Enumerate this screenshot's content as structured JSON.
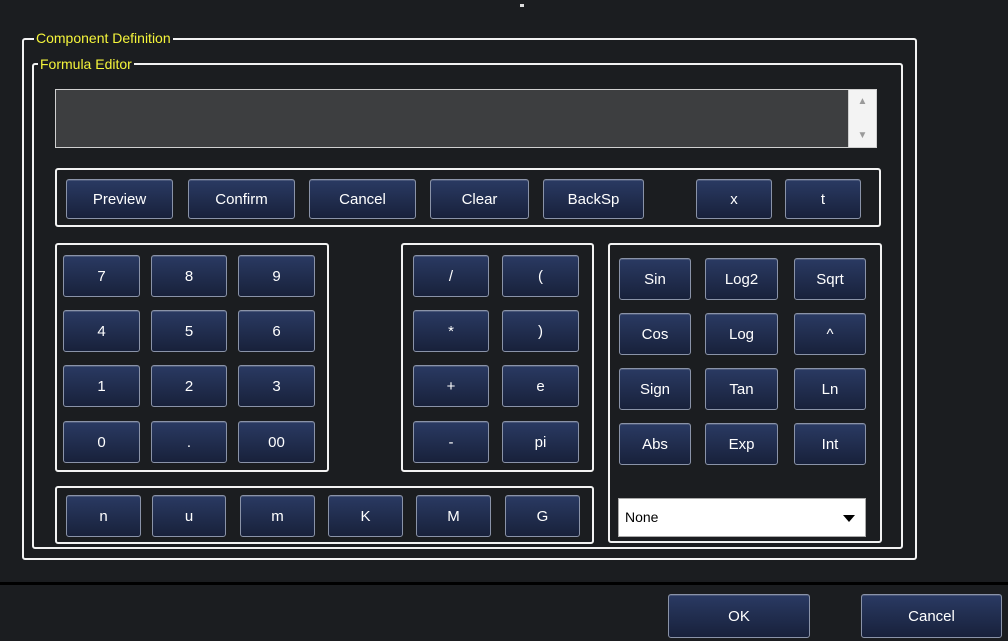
{
  "component_definition": {
    "label": "Component Definition"
  },
  "formula_editor": {
    "label": "Formula Editor",
    "formula_value": ""
  },
  "actions": {
    "preview": "Preview",
    "confirm": "Confirm",
    "cancel": "Cancel",
    "clear": "Clear",
    "backsp": "BackSp",
    "x": "x",
    "t": "t"
  },
  "keypad": {
    "k7": "7",
    "k8": "8",
    "k9": "9",
    "k4": "4",
    "k5": "5",
    "k6": "6",
    "k1": "1",
    "k2": "2",
    "k3": "3",
    "k0": "0",
    "kdot": ".",
    "k00": "00"
  },
  "operators": {
    "div": "/",
    "lparen": "(",
    "mul": "*",
    "rparen": ")",
    "plus": "+",
    "e": "e",
    "minus": "-",
    "pi": "pi"
  },
  "functions": {
    "sin": "Sin",
    "log2": "Log2",
    "sqrt": "Sqrt",
    "cos": "Cos",
    "log": "Log",
    "pow": "^",
    "sign": "Sign",
    "tan": "Tan",
    "ln": "Ln",
    "abs": "Abs",
    "exp": "Exp",
    "int": "Int"
  },
  "unit_select": {
    "value": "None"
  },
  "prefixes": {
    "n": "n",
    "u": "u",
    "m": "m",
    "K": "K",
    "M": "M",
    "G": "G"
  },
  "footer": {
    "ok": "OK",
    "cancel": "Cancel"
  }
}
